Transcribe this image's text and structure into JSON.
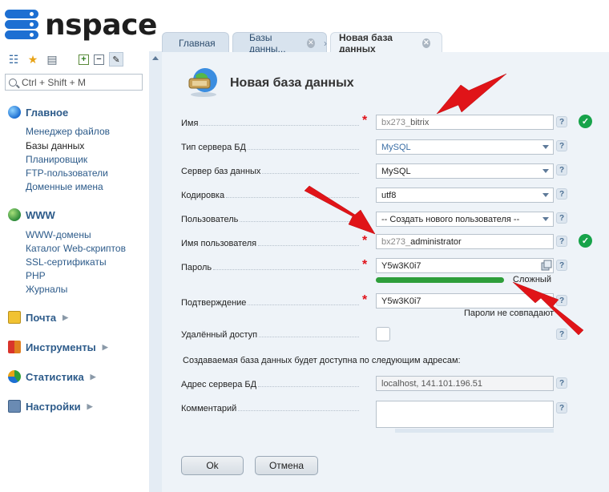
{
  "brand": {
    "name": "nspace"
  },
  "tabs": [
    {
      "label": "Главная",
      "closable": false
    },
    {
      "label": "Базы данны...",
      "closable": true
    },
    {
      "label": "Новая база данных",
      "closable": true,
      "active": true
    }
  ],
  "search": {
    "placeholder": "Ctrl + Shift + M"
  },
  "sidebar": {
    "sections": [
      {
        "label": "Главное",
        "icon": "globe-icon",
        "items": [
          "Менеджер файлов",
          "Базы данных",
          "Планировщик",
          "FTP-пользователи",
          "Доменные имена"
        ]
      },
      {
        "label": "WWW",
        "icon": "globe-icon",
        "items": [
          "WWW-домены",
          "Каталог Web-скриптов",
          "SSL-сертификаты",
          "PHP",
          "Журналы"
        ]
      },
      {
        "label": "Почта",
        "icon": "mail-icon",
        "items": []
      },
      {
        "label": "Инструменты",
        "icon": "tools-icon",
        "items": []
      },
      {
        "label": "Статистика",
        "icon": "chart-icon",
        "items": []
      },
      {
        "label": "Настройки",
        "icon": "settings-icon",
        "items": []
      }
    ],
    "current_item": "Базы данных"
  },
  "form": {
    "title": "Новая база данных",
    "fields": {
      "name": {
        "label": "Имя",
        "prefix": "bx273_",
        "value": "bitrix"
      },
      "server_type": {
        "label": "Тип сервера БД",
        "value": "MySQL"
      },
      "db_server": {
        "label": "Сервер баз данных",
        "value": "MySQL"
      },
      "charset": {
        "label": "Кодировка",
        "value": "utf8"
      },
      "user": {
        "label": "Пользователь",
        "value": "-- Создать нового пользователя --"
      },
      "username": {
        "label": "Имя пользователя",
        "prefix": "bx273_",
        "value": "administrator"
      },
      "password": {
        "label": "Пароль",
        "value": "Y5w3K0i7",
        "strength": "Сложный",
        "strength_level": 1.0
      },
      "confirm": {
        "label": "Подтверждение",
        "value": "Y5w3K0i7",
        "mismatch": "Пароли не совпадают"
      },
      "remote": {
        "label": "Удалённый доступ",
        "checked": false
      },
      "address": {
        "label": "Адрес сервера БД",
        "value": "localhost, 141.101.196.51"
      },
      "comment": {
        "label": "Комментарий",
        "value": ""
      }
    },
    "info": "Создаваемая база данных будет доступна по следующим адресам:",
    "help_symbol": "?",
    "buttons": {
      "ok": "Ok",
      "cancel": "Отмена"
    }
  },
  "colors": {
    "accent": "#1d6fd2",
    "required": "#e0121a",
    "valid": "#17a34a",
    "arrow": "#e01418"
  }
}
